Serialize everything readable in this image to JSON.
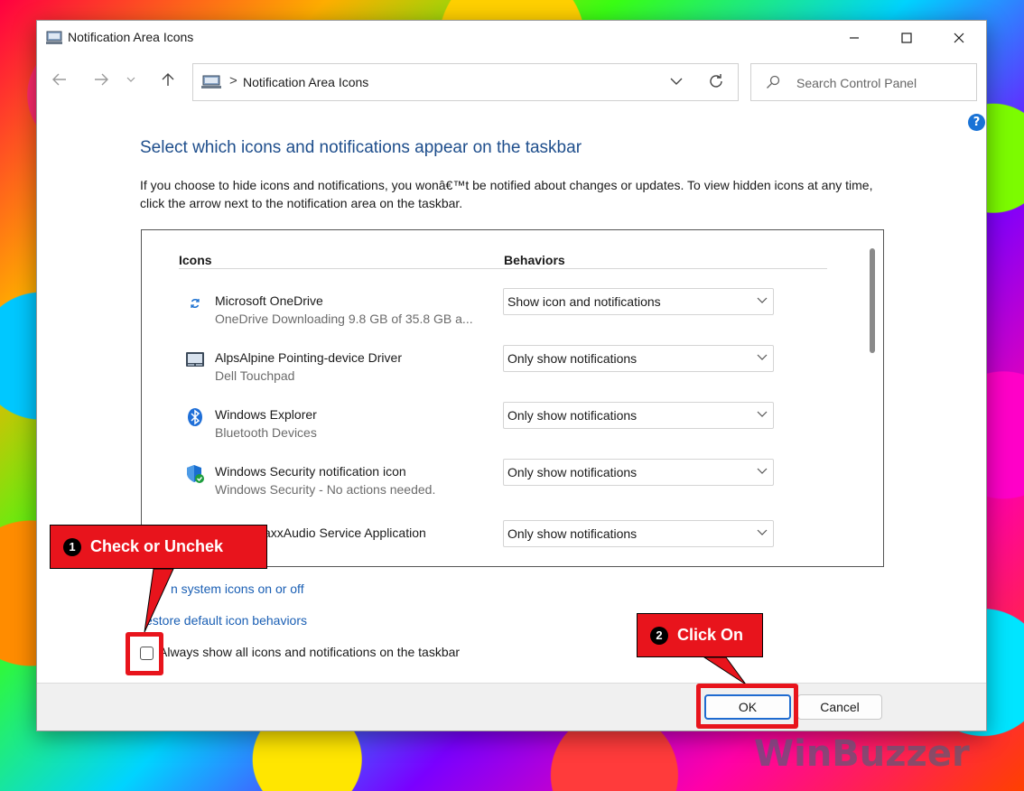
{
  "window": {
    "title": "Notification Area Icons"
  },
  "address_bar": {
    "path": "Notification Area Icons",
    "separator": ">"
  },
  "search": {
    "placeholder": "Search Control Panel"
  },
  "help_label": "?",
  "page": {
    "heading": "Select which icons and notifications appear on the taskbar",
    "description": "If you choose to hide icons and notifications, you wonâ€™t be notified about changes or updates. To view hidden icons at any time, click the arrow next to the notification area on the taskbar."
  },
  "table": {
    "col_icons": "Icons",
    "col_behaviors": "Behaviors",
    "rows": [
      {
        "icon": "onedrive-sync-icon",
        "name": "Microsoft OneDrive",
        "sub": "OneDrive Downloading 9.8 GB of 35.8 GB a...",
        "behavior": "Show icon and notifications"
      },
      {
        "icon": "touchpad-icon",
        "name": "AlpsAlpine Pointing-device Driver",
        "sub": "Dell Touchpad",
        "behavior": "Only show notifications"
      },
      {
        "icon": "bluetooth-icon",
        "name": "Windows Explorer",
        "sub": "Bluetooth Devices",
        "behavior": "Only show notifications"
      },
      {
        "icon": "shield-check-icon",
        "name": "Windows Security notification icon",
        "sub": "Windows Security - No actions needed.",
        "behavior": "Only show notifications"
      },
      {
        "icon": "audio-app-icon",
        "name": "axxAudio Service Application",
        "sub": "",
        "behavior": "Only show notifications"
      }
    ]
  },
  "links": {
    "system_icons": "n system icons on or off",
    "restore_defaults": "estore default icon behaviors"
  },
  "always_show": {
    "label": "Always show all icons and notifications on the taskbar",
    "checked": false
  },
  "buttons": {
    "ok": "OK",
    "cancel": "Cancel"
  },
  "callouts": {
    "one": {
      "number": "1",
      "text": "Check or Unchek"
    },
    "two": {
      "number": "2",
      "text": "Click On"
    }
  },
  "watermark": "WinBuzzer",
  "colors": {
    "heading": "#1e4e8c",
    "link": "#1a5fb4",
    "callout": "#e8141c",
    "ok_border": "#1f6bd0"
  }
}
